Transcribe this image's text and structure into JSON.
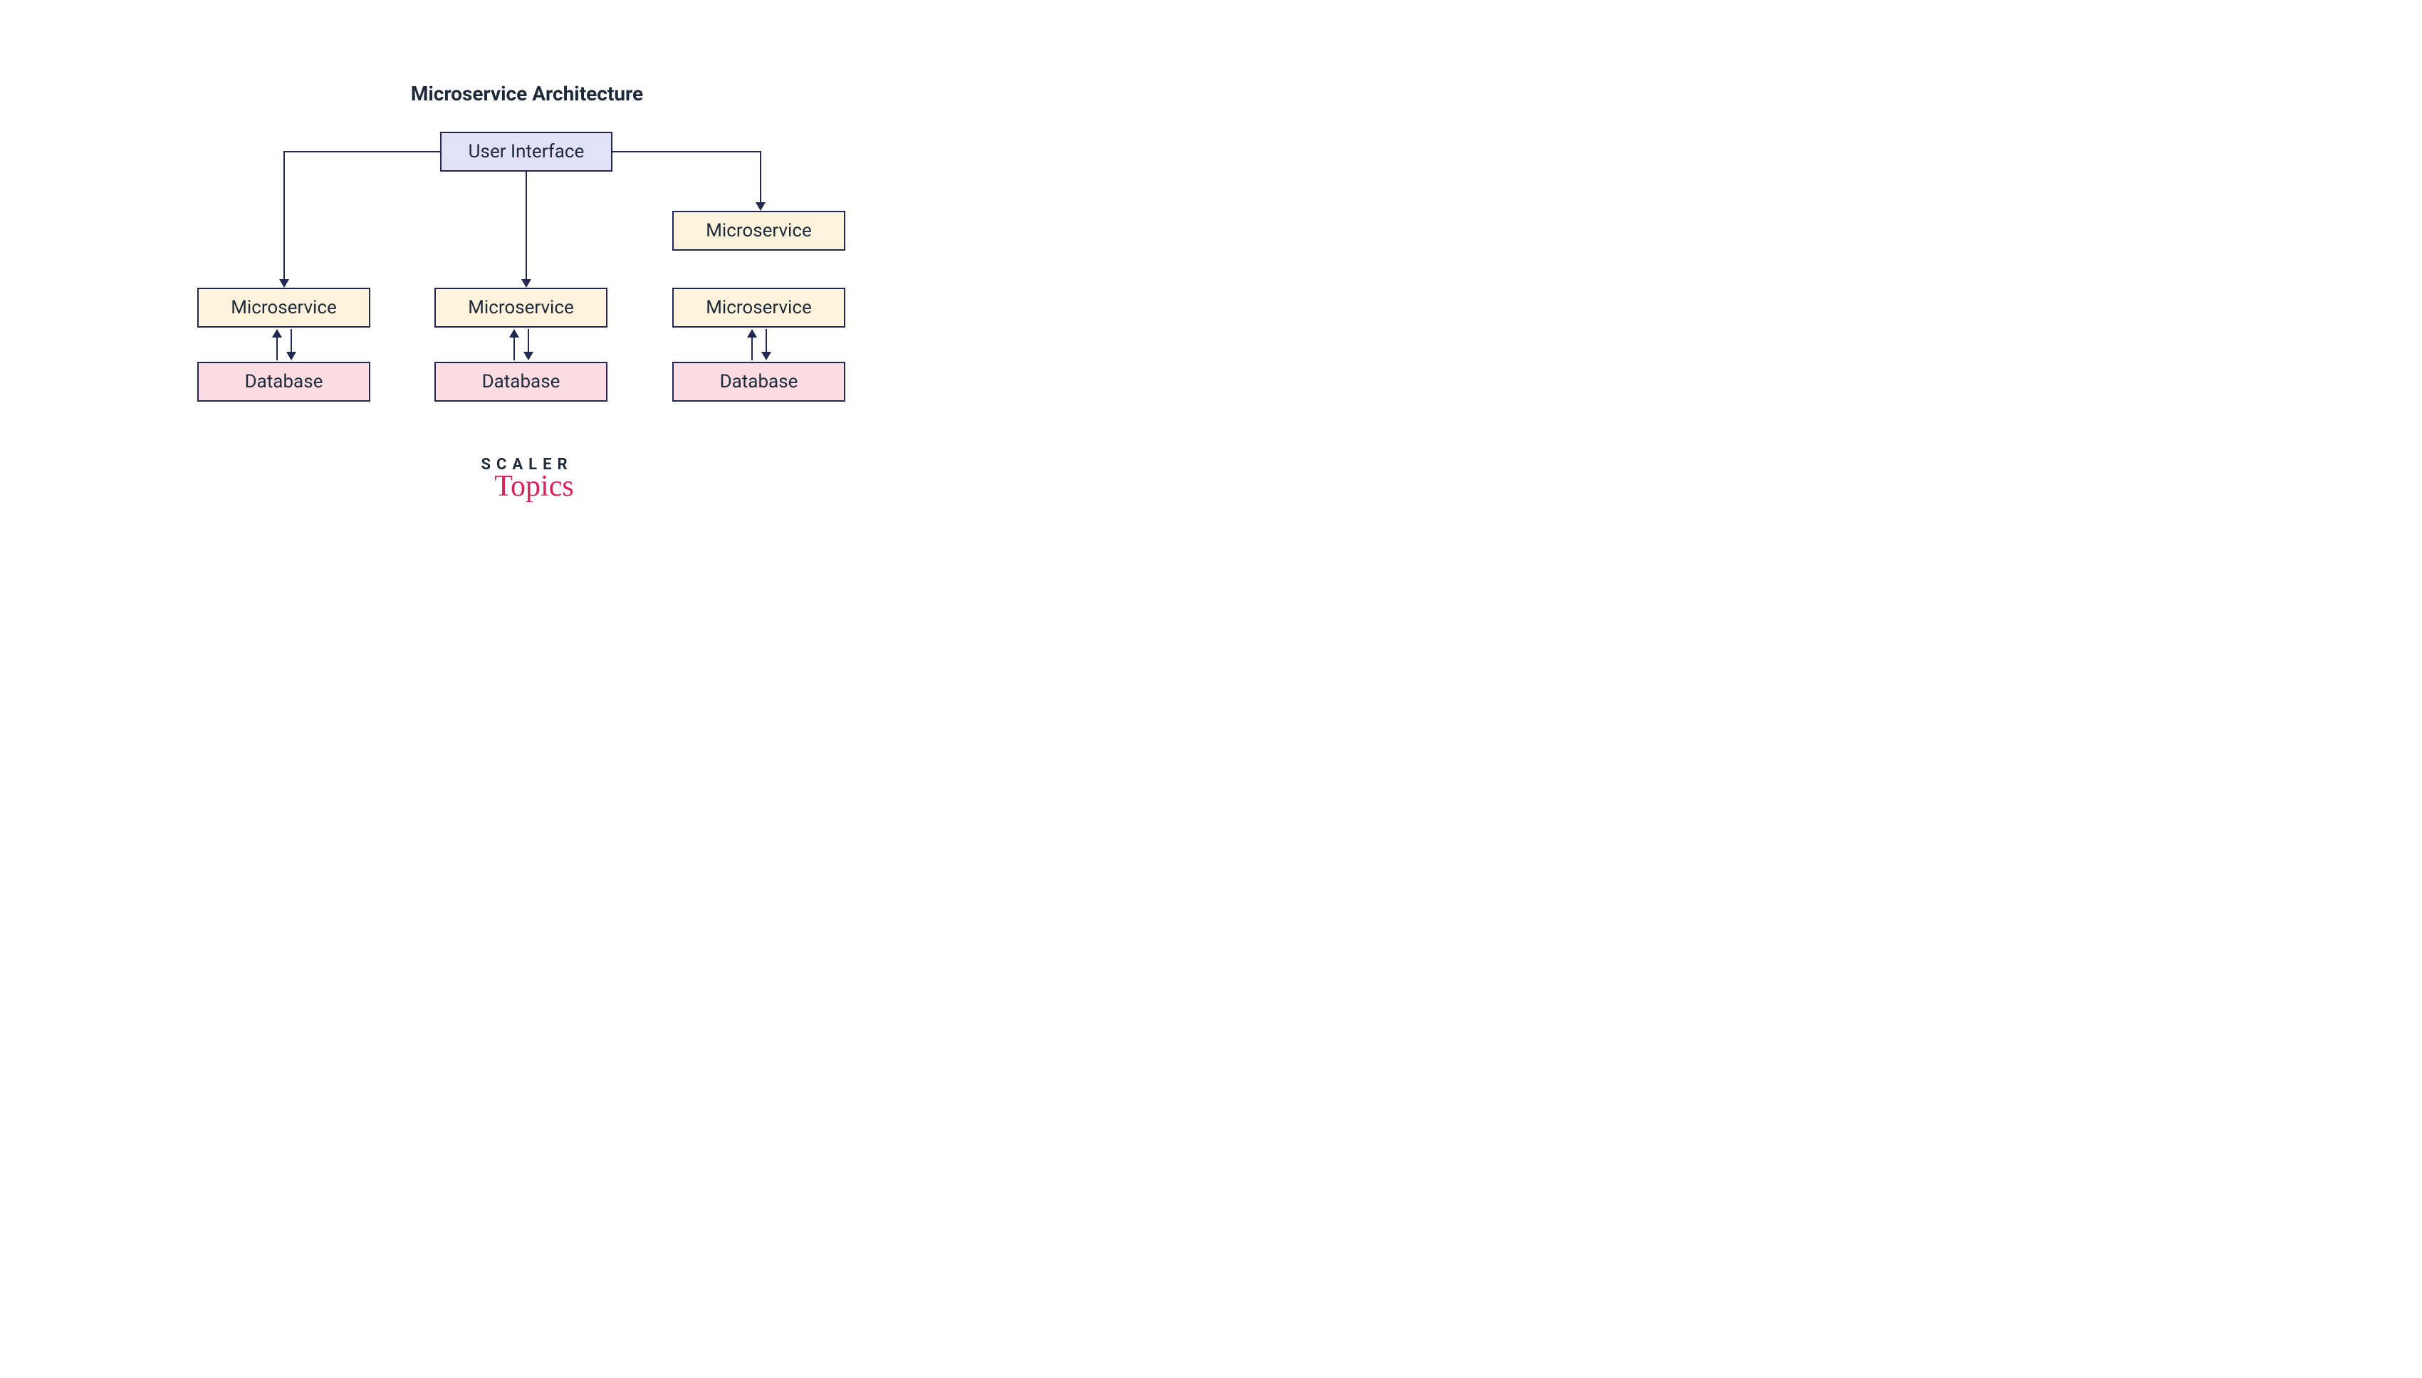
{
  "title": "Microservice Architecture",
  "nodes": {
    "user_interface": "User Interface",
    "microservice_1": "Microservice",
    "microservice_2": "Microservice",
    "microservice_3_top": "Microservice",
    "microservice_3_bottom": "Microservice",
    "database_1": "Database",
    "database_2": "Database",
    "database_3": "Database"
  },
  "logo": {
    "line1": "SCALER",
    "line2": "Topics"
  },
  "colors": {
    "border": "#22284f",
    "text": "#1e2a3a",
    "ui_fill": "#e3e1f7",
    "microservice_fill": "#fdf3dc",
    "database_fill": "#fadce2",
    "logo_accent": "#e01e5a"
  },
  "connections": [
    {
      "from": "user_interface",
      "to": "microservice_1",
      "type": "down"
    },
    {
      "from": "user_interface",
      "to": "microservice_2",
      "type": "down"
    },
    {
      "from": "user_interface",
      "to": "microservice_3_top",
      "type": "down"
    },
    {
      "from": "microservice_1",
      "to": "database_1",
      "type": "bidirectional"
    },
    {
      "from": "microservice_2",
      "to": "database_2",
      "type": "bidirectional"
    },
    {
      "from": "microservice_3_bottom",
      "to": "database_3",
      "type": "bidirectional"
    }
  ]
}
